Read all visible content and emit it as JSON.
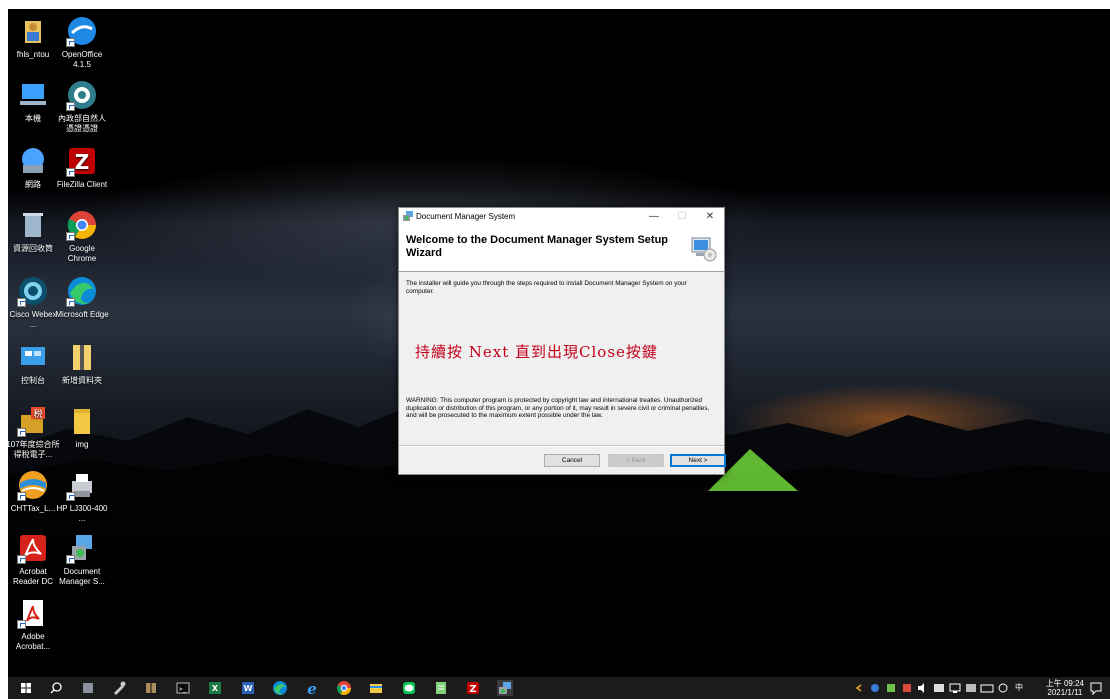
{
  "desktop": {
    "icons": [
      {
        "label": "fhls_ntou"
      },
      {
        "label": "OpenOffice 4.1.5"
      },
      {
        "label": "本機"
      },
      {
        "label": "內政部自然人憑證憑證"
      },
      {
        "label": "網路"
      },
      {
        "label": "FileZilla Client"
      },
      {
        "label": "資源回收筒"
      },
      {
        "label": "Google Chrome"
      },
      {
        "label": "Cisco Webex ..."
      },
      {
        "label": "Microsoft Edge"
      },
      {
        "label": "控制台"
      },
      {
        "label": "新增資料夾"
      },
      {
        "label": "107年度綜合所得稅電子..."
      },
      {
        "label": "img"
      },
      {
        "label": "CHTTax_L..."
      },
      {
        "label": "HP LJ300-400 ..."
      },
      {
        "label": "Acrobat Reader DC"
      },
      {
        "label": "Document Manager S..."
      },
      {
        "label": "Adobe Acrobat..."
      }
    ]
  },
  "dialog": {
    "title": "Document Manager System",
    "heading": "Welcome to the Document Manager System Setup Wizard",
    "intro": "The installer will guide you through the steps required to install Document Manager System on your computer.",
    "note": "持續按 Next 直到出現Close按鍵",
    "warning": "WARNING: This computer program is protected by copyright law and international treaties. Unauthorized duplication or distribution of this program, or any portion of it, may result in severe civil or criminal penalties, and will be prosecuted to the maximum extent possible under the law.",
    "buttons": {
      "cancel": "Cancel",
      "back": "< Back",
      "next": "Next >"
    },
    "controls": {
      "minimize": "—",
      "maximize": "☐",
      "close": "✕"
    }
  },
  "taskbar": {
    "clock": {
      "time": "上午 09:24",
      "date": "2021/1/11"
    },
    "tray_lang": "中"
  }
}
